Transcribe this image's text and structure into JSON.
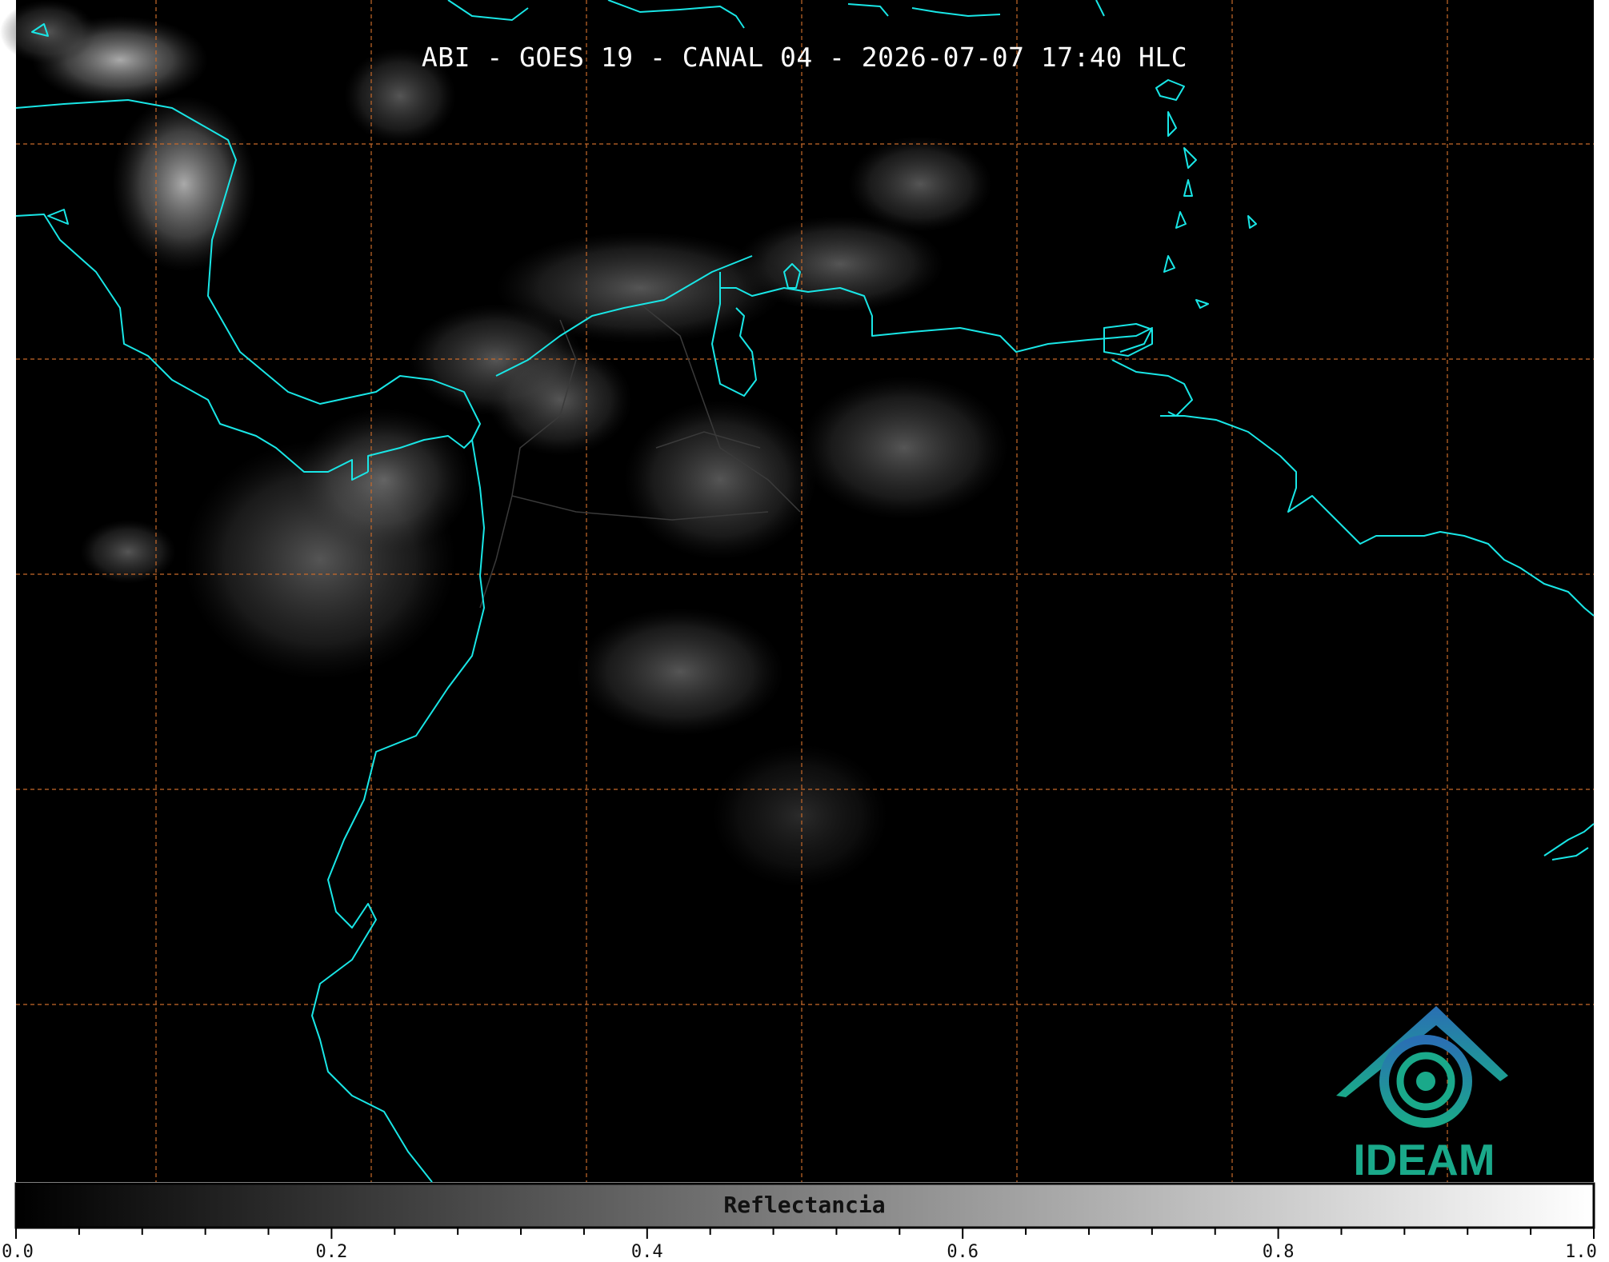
{
  "title": "ABI - GOES 19 - CANAL 04 - 2026-07-07 17:40 HLC",
  "colors": {
    "background": "#000000",
    "coastline": "#19e6e6",
    "gridline": "#c86a2a",
    "border": "#2a2a2a",
    "logo_blue": "#2a6fb4",
    "logo_green": "#1aa98a"
  },
  "colorbar": {
    "label": "Reflectancia",
    "min": 0.0,
    "max": 1.0,
    "tick_labels": [
      "0.0",
      "0.2",
      "0.4",
      "0.6",
      "0.8",
      "1.0"
    ],
    "minor_ticks_per_major": 4
  },
  "logo": {
    "text": "IDEAM",
    "icon": "ideam-mountain-swirl-icon"
  }
}
